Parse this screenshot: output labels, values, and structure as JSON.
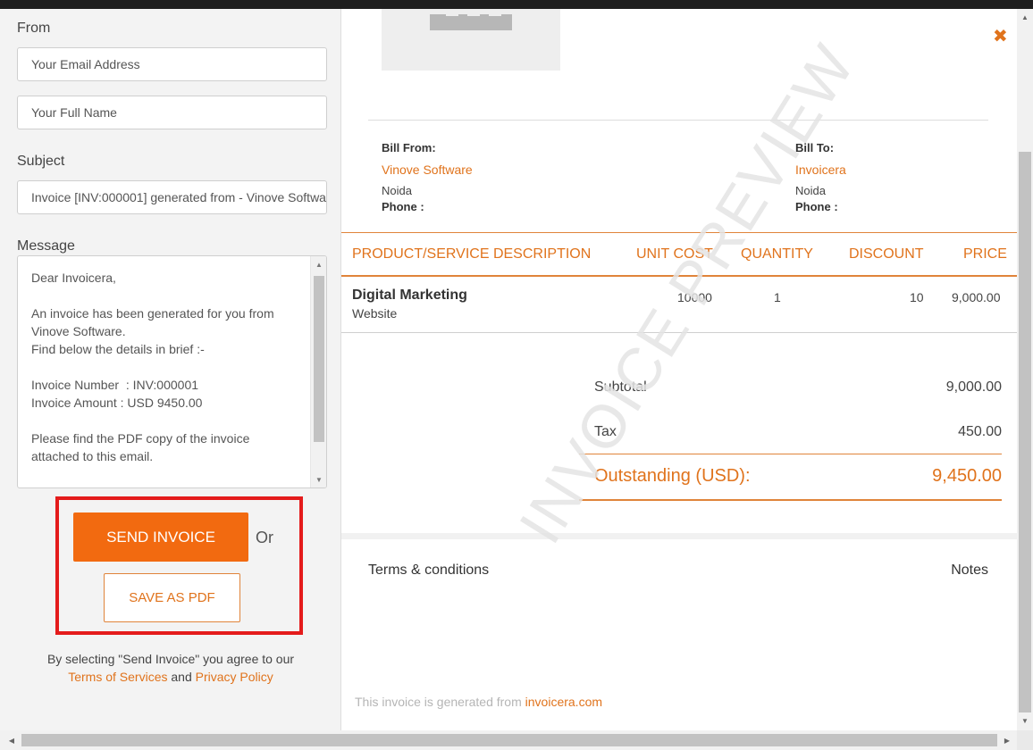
{
  "form": {
    "from_label": "From",
    "email_placeholder": "Your Email Address",
    "name_placeholder": "Your Full Name",
    "subject_label": "Subject",
    "subject_value": "Invoice [INV:000001]  generated from - Vinove Software",
    "message_label": "Message",
    "message_value": "Dear Invoicera,\n\nAn invoice has been generated for you from Vinove Software.\nFind below the details in brief :-\n\nInvoice Number  : INV:000001\nInvoice Amount : USD 9450.00\n\nPlease find the PDF copy of the invoice attached to this email.\n\nRegards,",
    "send_label": "SEND INVOICE",
    "or_label": "Or",
    "save_pdf_label": "SAVE AS PDF",
    "agree_text": "By selecting \"Send Invoice\" you agree to our",
    "terms_link": "Terms of Services",
    "and_text": "and",
    "privacy_link": "Privacy Policy"
  },
  "preview": {
    "close_symbol": "✖",
    "watermark": "INVOICE PREVIEW",
    "bill_from": {
      "heading": "Bill From:",
      "name": "Vinove Software",
      "city": "Noida",
      "phone": "Phone :"
    },
    "bill_to": {
      "heading": "Bill To:",
      "name": "Invoicera",
      "city": "Noida",
      "phone": "Phone :"
    },
    "columns": [
      "PRODUCT/SERVICE DESCRIPTION",
      "UNIT COST",
      "QUANTITY",
      "DISCOUNT",
      "PRICE"
    ],
    "items": [
      {
        "name": "Digital Marketing",
        "desc": "Website",
        "unit_cost": "10000",
        "quantity": "1",
        "discount": "10",
        "price": "9,000.00"
      }
    ],
    "subtotal_label": "Subtotal",
    "subtotal_value": "9,000.00",
    "tax_label": "Tax",
    "tax_value": "450.00",
    "outstanding_label": "Outstanding (USD):",
    "outstanding_value": "9,450.00",
    "terms_label": "Terms & conditions",
    "notes_label": "Notes",
    "footer_text": "This invoice is generated from",
    "footer_link": "invoicera.com"
  },
  "colors": {
    "accent": "#f26a10",
    "accent_text": "#e0731c",
    "highlight": "#e41b1b"
  }
}
